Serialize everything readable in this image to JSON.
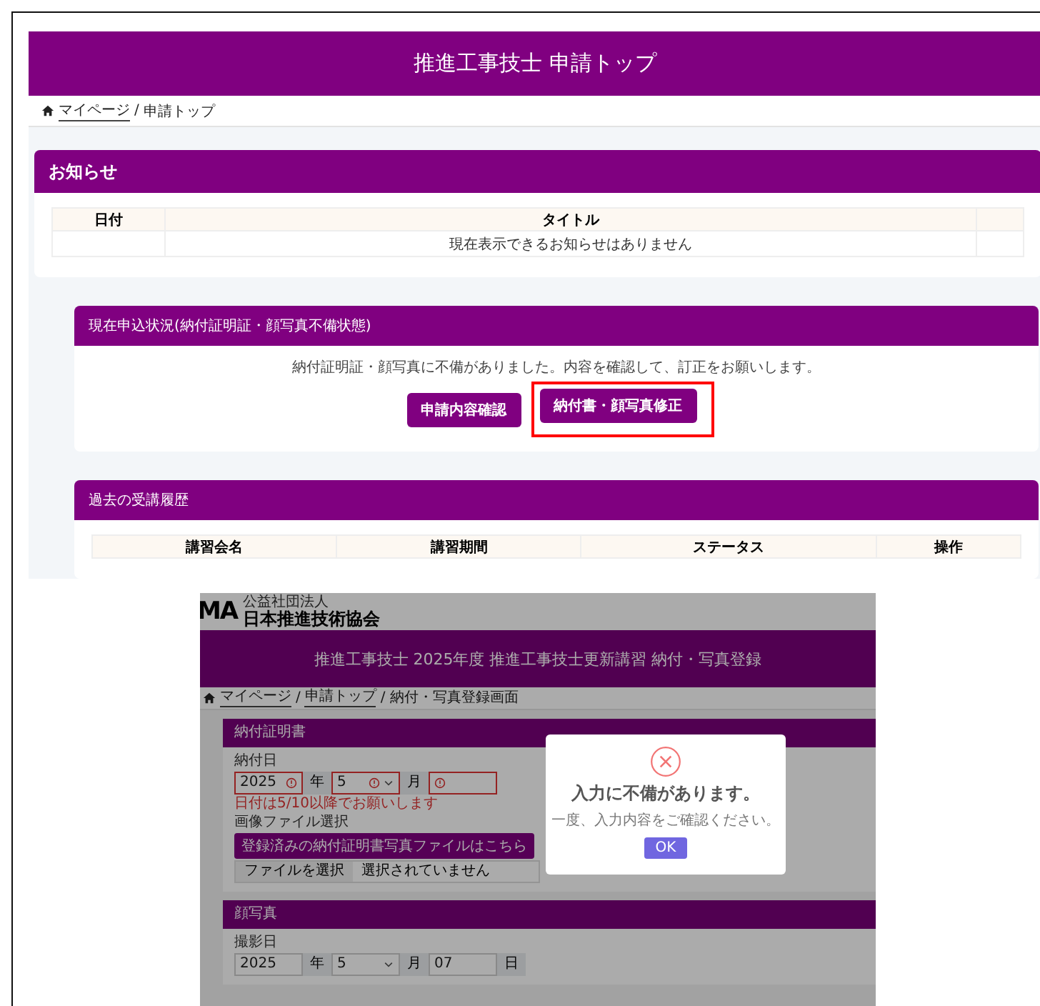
{
  "notice_page": {
    "title": "推進工事技士 申請トップ",
    "breadcrumb": [
      "マイページ",
      "申請トップ"
    ],
    "breadcrumb_separator": "/",
    "notices": {
      "heading": "お知らせ",
      "columns": [
        "日付",
        "タイトル"
      ],
      "empty_message": "現在表示できるお知らせはありません"
    },
    "status": {
      "heading": "現在申込状況(納付証明証・顔写真不備状態)",
      "message": "納付証明証・顔写真に不備がありました。内容を確認して、訂正をお願いします。",
      "buttons": [
        {
          "label": "申請内容確認",
          "highlighted": false
        },
        {
          "label": "納付書・顔写真修正",
          "highlighted": true
        }
      ]
    },
    "history": {
      "heading": "過去の受講履歴",
      "columns": [
        "講習会名",
        "講習期間",
        "ステータス",
        "操作"
      ]
    }
  },
  "registration_page": {
    "org": {
      "logo": "MA",
      "type": "公益社団法人",
      "name": "日本推進技術協会"
    },
    "title": "推進工事技士 2025年度 推進工事技士更新講習 納付・写真登録",
    "breadcrumb": [
      "マイページ",
      "申請トップ",
      "納付・写真登録画面"
    ],
    "breadcrumb_separator": "/",
    "payment": {
      "heading": "納付証明書",
      "date_label": "納付日",
      "fields": [
        {
          "value": "2025",
          "unit": "年",
          "error": true,
          "dropdown": false
        },
        {
          "value": "5",
          "unit": "月",
          "error": true,
          "dropdown": true
        },
        {
          "error": true,
          "dropdown": false
        }
      ],
      "error_message": "日付は5/10以降でお願いします",
      "file_label": "画像ファイル選択",
      "registered_button": "登録済みの納付証明書写真ファイルはこちら",
      "file_button": "ファイルを選択",
      "file_status": "選択されていません"
    },
    "photo": {
      "heading": "顔写真",
      "date_label": "撮影日",
      "fields": [
        {
          "value": "2025",
          "unit": "年",
          "error": false,
          "dropdown": false
        },
        {
          "value": "5",
          "unit": "月",
          "error": false,
          "dropdown": true
        },
        {
          "value": "07",
          "unit": "日",
          "error": false,
          "dropdown": false
        }
      ]
    },
    "dialog": {
      "title": "入力に不備があります。",
      "message": "一度、入力内容をご確認ください。",
      "button": "OK"
    }
  }
}
